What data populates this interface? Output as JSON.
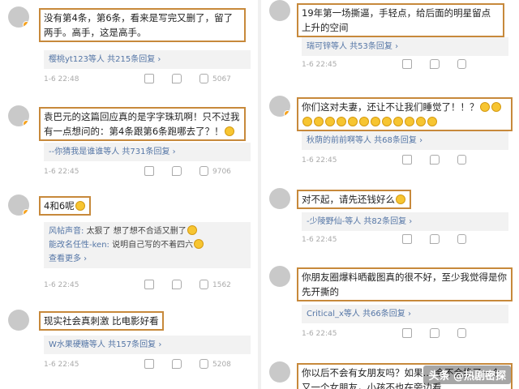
{
  "left": {
    "comments": [
      {
        "text": "没有第4条，第6条，看来是写完又删了，留了两手。高手，这是高手。",
        "reply_summary": "樱桃yt123等人  共215条回复 ›",
        "time": "1-6 22:48",
        "likes": "5067"
      },
      {
        "text": "袁巴元的这篇回应真的是字字珠玑啊！只不过我有一点想问的：第4条跟第6条跑哪去了？！",
        "reply_summary": "--你猜我是谁谁等人  共731条回复 ›",
        "time": "1-6 22:45",
        "likes": "9706"
      },
      {
        "text": "4和6呢",
        "replies": [
          {
            "user": "风帖声音:",
            "text": "太狠了 想了想不合适又删了"
          },
          {
            "user": "能改名任性-ken:",
            "text": "说明自己写的不着四六"
          }
        ],
        "more": "查看更多 ›",
        "time": "1-6 22:45",
        "likes": "1562"
      },
      {
        "text": "现实社会真刺激 比电影好看",
        "reply_summary": "W水果硬糖等人  共157条回复 ›",
        "time": "1-6 22:45",
        "likes": "5208"
      }
    ]
  },
  "right": {
    "comments": [
      {
        "text": "19年第一场撕逼，手轻点，给后面的明星留点上升的空间",
        "reply_summary": "瑞可锌等人  共53条回复 ›",
        "time": "1-6 22:45",
        "likes": ""
      },
      {
        "text": "你们这对夫妻，还让不让我们睡觉了！！？",
        "reply_summary": "秋荫的前前啊等人  共68条回复 ›",
        "time": "1-6 22:45",
        "likes": ""
      },
      {
        "text": "对不起，请先还钱好么",
        "reply_summary": "-少陵野仙-等人  共82条回复 ›",
        "time": "1-6 22:45",
        "likes": ""
      },
      {
        "text": "你朋友圈爆料晒截图真的很不好，至少我觉得是你先开撕的",
        "reply_summary": "Critical_x等人  共66条回复 ›",
        "time": "1-6 22:45",
        "likes": ""
      },
      {
        "text": "你以后不会有女朋友吗？如果… 会不会换了一个又一个女朋友，小孩不也在旁边看",
        "time": "",
        "likes": ""
      }
    ]
  },
  "watermark": {
    "text": "头条 @热剧密探"
  },
  "colors": {
    "highlight_border": "#c7893b",
    "link": "#5576a6",
    "reply_bg": "#f2f2f2"
  }
}
